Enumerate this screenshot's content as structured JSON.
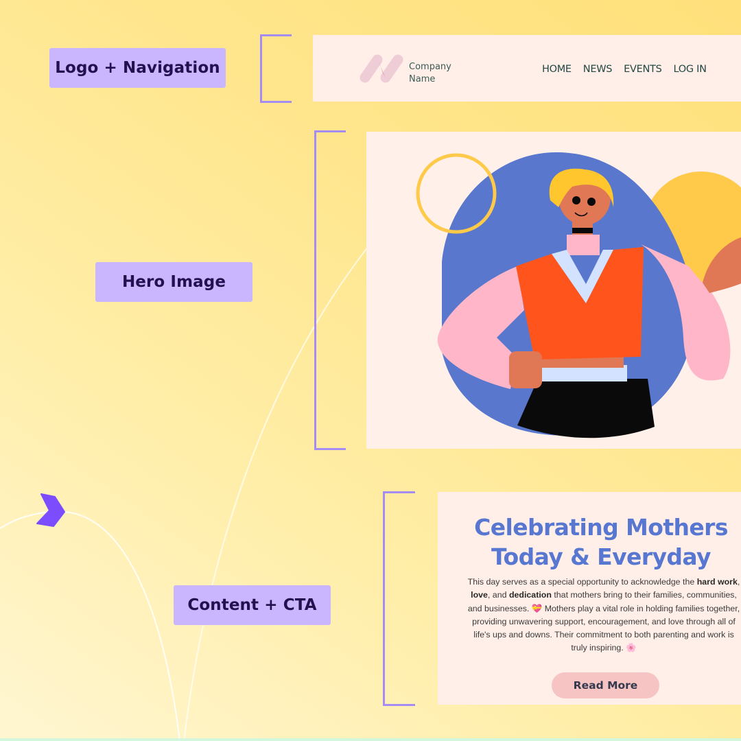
{
  "labels": {
    "logo_navigation": "Logo + Navigation",
    "hero_image": "Hero Image",
    "content_cta": "Content + CTA"
  },
  "nav": {
    "company_line1": "Company",
    "company_line2": "Name",
    "links": [
      "HOME",
      "NEWS",
      "EVENTS",
      "LOG IN"
    ]
  },
  "content": {
    "headline_line1": "Celebrating Mothers",
    "headline_line2": "Today & Everyday",
    "body": {
      "p1": "This day serves as a special opportunity to acknowledge the ",
      "b1": "hard work",
      "p2": ", ",
      "b2": "love",
      "p3": ", and ",
      "b3": "dedication",
      "p4": " that mothers bring to their families, communities, and businesses. ",
      "emoji1": "💝",
      "p5": " Mothers play a vital role in holding families together, providing unwavering support, encouragement, and love through all of life's ups and downs. Their commitment to both parenting and work is truly inspiring. ",
      "emoji2": "🌸"
    },
    "cta_label": "Read More"
  },
  "colors": {
    "label_bg": "#c9b6ff",
    "label_text": "#22104f",
    "bracket": "#a58cf5",
    "panel_bg": "#ffefe8",
    "headline": "#5877d1",
    "cta_bg": "#f7c4c4",
    "chevron": "#7b4dff"
  },
  "icons": {
    "chevron": "chevron-right-icon",
    "logo": "company-logo-icon"
  }
}
